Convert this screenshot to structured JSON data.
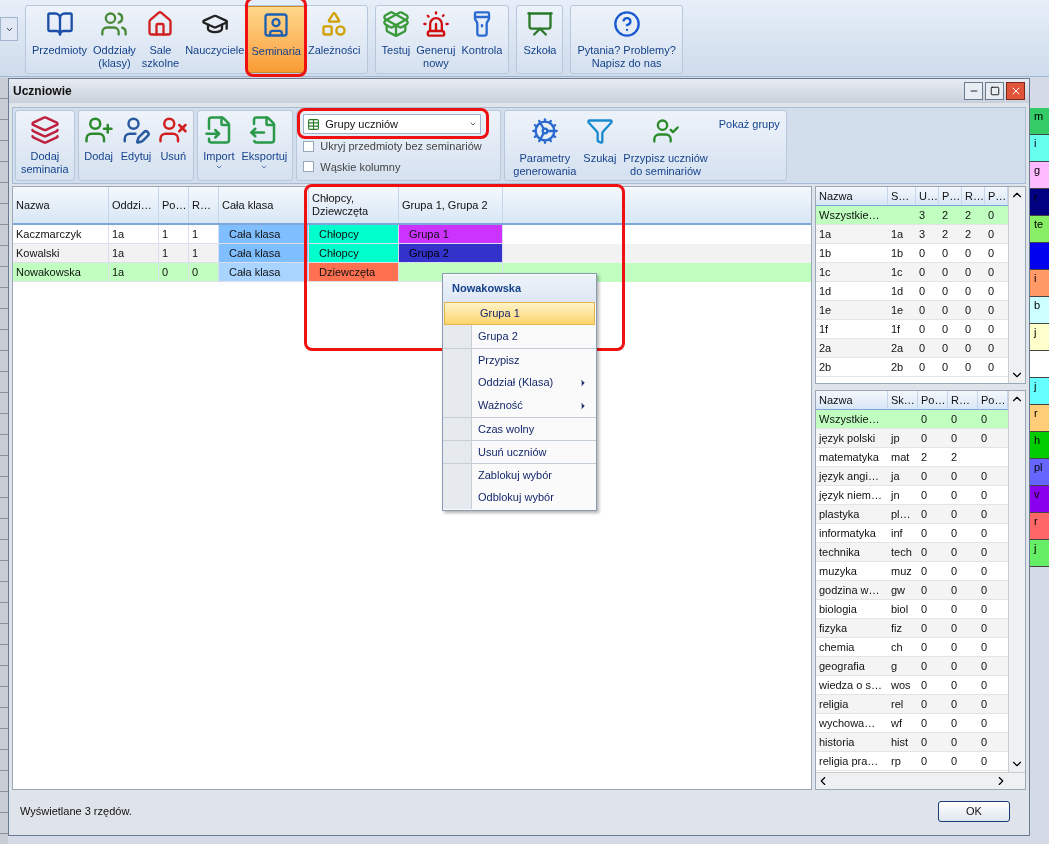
{
  "main_ribbon": {
    "groups": [
      {
        "items": [
          {
            "label": "Przedmioty",
            "selected": false,
            "highlighted": false
          },
          {
            "label": "Oddziały\n(klasy)",
            "selected": false,
            "highlighted": false
          },
          {
            "label": "Sale\nszkolne",
            "selected": false,
            "highlighted": false
          },
          {
            "label": "Nauczyciele",
            "selected": false,
            "highlighted": false
          },
          {
            "label": "Seminaria",
            "selected": true,
            "highlighted": true
          },
          {
            "label": "Zależności",
            "selected": false,
            "highlighted": false
          }
        ]
      },
      {
        "items": [
          {
            "label": "Testuj",
            "selected": false,
            "highlighted": false
          },
          {
            "label": "Generuj\nnowy",
            "selected": false,
            "highlighted": false
          },
          {
            "label": "Kontrola",
            "selected": false,
            "highlighted": false
          }
        ]
      },
      {
        "items": [
          {
            "label": "Szkoła",
            "selected": false,
            "highlighted": false
          }
        ]
      },
      {
        "items": [
          {
            "label": "Pytania? Problemy?\nNapisz do nas",
            "selected": false,
            "highlighted": false
          }
        ]
      }
    ]
  },
  "window": {
    "title": "Uczniowie",
    "ribbon": {
      "groups": [
        {
          "buttons": [
            {
              "label": "Dodaj\nseminaria",
              "dropdown": false
            }
          ]
        },
        {
          "buttons": [
            {
              "label": "Dodaj",
              "dropdown": false
            },
            {
              "label": "Edytuj",
              "dropdown": false
            },
            {
              "label": "Usuń",
              "dropdown": false
            }
          ]
        },
        {
          "buttons": [
            {
              "label": "Import",
              "dropdown": true
            },
            {
              "label": "Eksportuj",
              "dropdown": true
            }
          ]
        }
      ],
      "view_select": {
        "value": "Grupy uczniów",
        "highlighted": true
      },
      "checkboxes": [
        {
          "label": "Ukryj przedmioty bez seminariów",
          "checked": false
        },
        {
          "label": "Wąskie kolumny",
          "checked": false
        }
      ],
      "tools": [
        {
          "label": "Parametry\ngenerowania"
        },
        {
          "label": "Szukaj"
        },
        {
          "label": "Przypisz uczniów\ndo seminariów"
        }
      ],
      "tools_caption": "Pokaż grupy"
    },
    "students": {
      "group_columns_highlighted": true,
      "columns": [
        "Nazwa",
        "Oddzi…",
        "Po…",
        "R…",
        "Cała klasa",
        "Chłopcy,\nDziewczęta",
        "Grupa 1, Grupa 2"
      ],
      "rows": [
        {
          "selected": false,
          "cells": [
            {
              "text": "Kaczmarczyk"
            },
            {
              "text": "1a"
            },
            {
              "text": "1"
            },
            {
              "text": "1"
            },
            {
              "text": "Cała klasa",
              "color": "#80bfff"
            },
            {
              "text": "Chłopcy",
              "color": "#00ffcc"
            },
            {
              "text": "Grupa 1",
              "color": "#cc33ff"
            }
          ]
        },
        {
          "selected": false,
          "cells": [
            {
              "text": "Kowalski"
            },
            {
              "text": "1a"
            },
            {
              "text": "1"
            },
            {
              "text": "1"
            },
            {
              "text": "Cała klasa",
              "color": "#80bfff"
            },
            {
              "text": "Chłopcy",
              "color": "#00ffcc"
            },
            {
              "text": "Grupa 2",
              "color": "#3333cc"
            }
          ]
        },
        {
          "selected": true,
          "cells": [
            {
              "text": "Nowakowska"
            },
            {
              "text": "1a"
            },
            {
              "text": "0"
            },
            {
              "text": "0"
            },
            {
              "text": "Cała klasa",
              "color": "#a8d4ff"
            },
            {
              "text": "Dziewczęta",
              "color": "#ff7050"
            },
            {}
          ]
        }
      ]
    },
    "context_menu": {
      "title": "Nowakowska",
      "items": [
        {
          "label": "Grupa 1",
          "selected": true,
          "submenu": false,
          "separator_before": false
        },
        {
          "label": "Grupa 2",
          "selected": false,
          "submenu": false,
          "separator_before": false
        },
        {
          "label": "Przypisz",
          "selected": false,
          "submenu": false,
          "separator_before": true
        },
        {
          "label": "Oddział (Klasa)",
          "selected": false,
          "submenu": true,
          "separator_before": false
        },
        {
          "label": "Ważność",
          "selected": false,
          "submenu": true,
          "separator_before": false
        },
        {
          "label": "Czas wolny",
          "selected": false,
          "submenu": false,
          "separator_before": true
        },
        {
          "label": "Usuń uczniów",
          "selected": false,
          "submenu": false,
          "separator_before": true
        },
        {
          "label": "Zablokuj wybór",
          "selected": false,
          "submenu": false,
          "separator_before": true
        },
        {
          "label": "Odblokuj wybór",
          "selected": false,
          "submenu": false,
          "separator_before": false
        }
      ]
    },
    "classes_table": {
      "columns": [
        "Nazwa",
        "S…",
        "U…",
        "P…",
        "R…",
        "P…"
      ],
      "rows": [
        {
          "selected": true,
          "cells": [
            "Wszystkie…",
            null,
            "3",
            "2",
            "2",
            "0"
          ]
        },
        {
          "selected": false,
          "cells": [
            "1a",
            "1a",
            "3",
            "2",
            "2",
            "0"
          ]
        },
        {
          "selected": false,
          "cells": [
            "1b",
            "1b",
            "0",
            "0",
            "0",
            "0"
          ]
        },
        {
          "selected": false,
          "cells": [
            "1c",
            "1c",
            "0",
            "0",
            "0",
            "0"
          ]
        },
        {
          "selected": false,
          "cells": [
            "1d",
            "1d",
            "0",
            "0",
            "0",
            "0"
          ]
        },
        {
          "selected": false,
          "cells": [
            "1e",
            "1e",
            "0",
            "0",
            "0",
            "0"
          ]
        },
        {
          "selected": false,
          "cells": [
            "1f",
            "1f",
            "0",
            "0",
            "0",
            "0"
          ]
        },
        {
          "selected": false,
          "cells": [
            "2a",
            "2a",
            "0",
            "0",
            "0",
            "0"
          ]
        },
        {
          "selected": false,
          "cells": [
            "2b",
            "2b",
            "0",
            "0",
            "0",
            "0"
          ]
        }
      ]
    },
    "subjects_table": {
      "columns": [
        "Nazwa",
        "Sk…",
        "Po…",
        "R…",
        "Po…"
      ],
      "rows": [
        {
          "selected": true,
          "cells": [
            "Wszystkie…",
            null,
            "0",
            "0",
            "0"
          ]
        },
        {
          "selected": false,
          "cells": [
            "język polski",
            "jp",
            "0",
            "0",
            "0"
          ]
        },
        {
          "selected": false,
          "cells": [
            "matematyka",
            "mat",
            "2",
            "2",
            null
          ]
        },
        {
          "selected": false,
          "cells": [
            "język angi…",
            "ja",
            "0",
            "0",
            "0"
          ]
        },
        {
          "selected": false,
          "cells": [
            "język niem…",
            "jn",
            "0",
            "0",
            "0"
          ]
        },
        {
          "selected": false,
          "cells": [
            "plastyka",
            "pl…",
            "0",
            "0",
            "0"
          ]
        },
        {
          "selected": false,
          "cells": [
            "informatyka",
            "inf",
            "0",
            "0",
            "0"
          ]
        },
        {
          "selected": false,
          "cells": [
            "technika",
            "tech",
            "0",
            "0",
            "0"
          ]
        },
        {
          "selected": false,
          "cells": [
            "muzyka",
            "muz",
            "0",
            "0",
            "0"
          ]
        },
        {
          "selected": false,
          "cells": [
            "godzina w…",
            "gw",
            "0",
            "0",
            "0"
          ]
        },
        {
          "selected": false,
          "cells": [
            "biologia",
            "biol",
            "0",
            "0",
            "0"
          ]
        },
        {
          "selected": false,
          "cells": [
            "fizyka",
            "fiz",
            "0",
            "0",
            "0"
          ]
        },
        {
          "selected": false,
          "cells": [
            "chemia",
            "ch",
            "0",
            "0",
            "0"
          ]
        },
        {
          "selected": false,
          "cells": [
            "geografia",
            "g",
            "0",
            "0",
            "0"
          ]
        },
        {
          "selected": false,
          "cells": [
            "wiedza o s…",
            "wos",
            "0",
            "0",
            "0"
          ]
        },
        {
          "selected": false,
          "cells": [
            "religia",
            "rel",
            "0",
            "0",
            "0"
          ]
        },
        {
          "selected": false,
          "cells": [
            "wychowa…",
            "wf",
            "0",
            "0",
            "0"
          ]
        },
        {
          "selected": false,
          "cells": [
            "historia",
            "hist",
            "0",
            "0",
            "0"
          ]
        },
        {
          "selected": false,
          "cells": [
            "religia pra…",
            "rp",
            "0",
            "0",
            "0"
          ]
        }
      ]
    },
    "status_bar": {
      "text": "Wyświetlane 3 rzędów.",
      "button": "OK"
    }
  },
  "background_cells": [
    {
      "text": "m",
      "color": "#33cc66"
    },
    {
      "text": "i",
      "color": "#66ffee"
    },
    {
      "text": "g",
      "color": "#ffbbff"
    },
    {
      "text": "r",
      "color": "#000080"
    },
    {
      "text": "te",
      "color": "#88ee66"
    },
    {
      "color": "#0000ee"
    },
    {
      "text": "i",
      "color": "#ff9966"
    },
    {
      "text": "b",
      "color": "#ccffff"
    },
    {
      "text": "j",
      "color": "#ffffcc"
    },
    {
      "color": "#ffffff"
    },
    {
      "text": "j",
      "color": "#66ffff"
    },
    {
      "text": "r",
      "color": "#ffcc77"
    },
    {
      "text": "h",
      "color": "#00cc00"
    },
    {
      "text": "pl",
      "color": "#6666ff"
    },
    {
      "text": "v",
      "color": "#8800ee"
    },
    {
      "text": "r",
      "color": "#ff6666"
    },
    {
      "text": "j",
      "color": "#66ee66"
    }
  ]
}
